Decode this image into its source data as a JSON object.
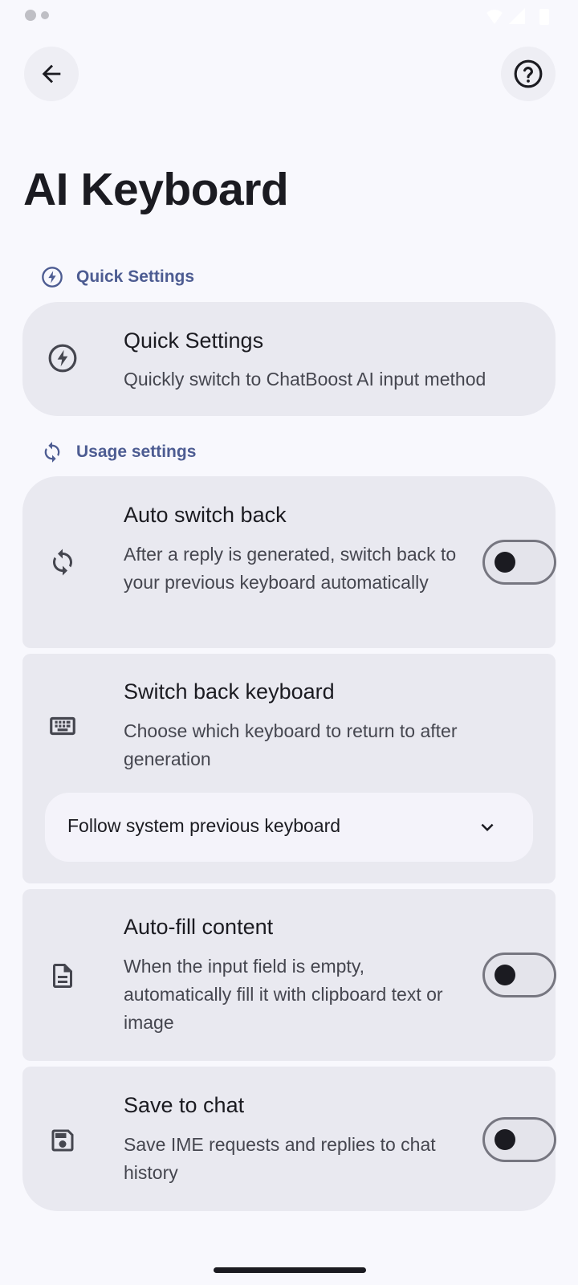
{
  "status_bar": {
    "icons": [
      "notification-icon",
      "wifi-icon",
      "signal-icon",
      "battery-icon"
    ]
  },
  "header": {
    "back_icon": "arrow-left-icon",
    "help_icon": "help-circle-icon",
    "title": "AI Keyboard"
  },
  "sections": {
    "quick": {
      "label": "Quick Settings",
      "icon": "bolt-circle-icon"
    },
    "usage": {
      "label": "Usage settings",
      "icon": "sync-icon"
    }
  },
  "cards": {
    "quick_settings": {
      "title": "Quick Settings",
      "description": "Quickly switch to ChatBoost AI input method",
      "icon": "bolt-circle-icon"
    },
    "auto_switch_back": {
      "title": "Auto switch back",
      "description": "After a reply is generated, switch back to your previous keyboard automatically",
      "icon": "sync-icon",
      "enabled": false
    },
    "switch_back_keyboard": {
      "title": "Switch back keyboard",
      "description": "Choose which keyboard to return to after generation",
      "icon": "keyboard-icon",
      "selected": "Follow system previous keyboard",
      "dropdown_icon": "chevron-down-icon"
    },
    "auto_fill": {
      "title": "Auto-fill content",
      "description": "When the input field is empty, automatically fill it with clipboard text or image",
      "icon": "document-icon",
      "enabled": false
    },
    "save_to_chat": {
      "title": "Save to chat",
      "description": "Save IME requests and replies to chat history",
      "icon": "save-icon",
      "enabled": false
    }
  },
  "colors": {
    "background": "#f8f8fd",
    "card": "#e9e9f0",
    "section_accent": "#4d5c92",
    "text_primary": "#1b1b21",
    "text_secondary": "#45464f",
    "toggle_outline": "#767680"
  }
}
